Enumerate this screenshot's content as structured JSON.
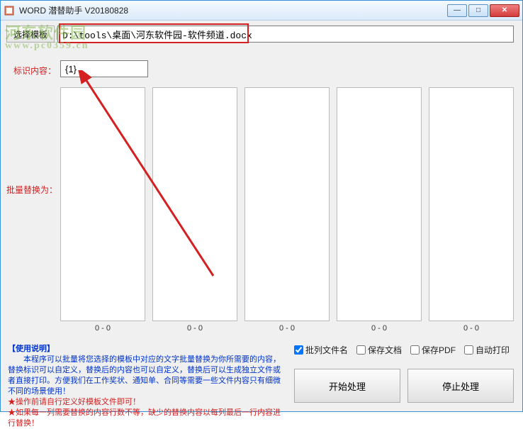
{
  "window": {
    "title": "WORD 潜替助手 V20180828"
  },
  "watermark": {
    "line1": "河东软件园",
    "line2": "www.pc0359.cn"
  },
  "toolbar": {
    "select_template": "选择模板"
  },
  "path": {
    "value": "D:\\tools\\桌面\\河东软件园-软件频道.docx"
  },
  "labels": {
    "ident": "标识内容：",
    "batch": "批量替换为："
  },
  "ident": {
    "value": "{1}"
  },
  "counts": [
    "0 - 0",
    "0 - 0",
    "0 - 0",
    "0 - 0",
    "0 - 0"
  ],
  "help": {
    "title": "【使用说明】",
    "l1": "　　本程序可以批量将您选择的模板中对应的文字批量替换为你所需要的内容，替换标识可以自定义，替换后的内容也可以自定义，替换后可以生成独立文件或者直接打印。方便我们在工作奖状、通知单、合同等需要一些文件内容只有细微不同的场景使用！",
    "l2": "★操作前请自行定义好模板文件即可！",
    "l3": "★如果每一列需要替换的内容行数不等，缺少的替换内容以每列最后一行内容进行替换！"
  },
  "checks": {
    "batch_filename": "批列文件名",
    "save_doc": "保存文档",
    "save_pdf": "保存PDF",
    "auto_print": "自动打印"
  },
  "buttons": {
    "start": "开始处理",
    "stop": "停止处理"
  }
}
